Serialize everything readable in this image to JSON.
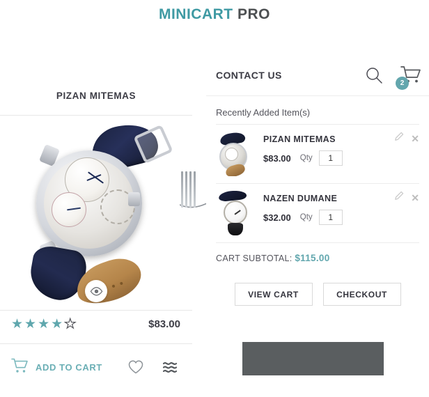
{
  "brand": {
    "title_primary": "MINICART",
    "title_secondary": "PRO"
  },
  "product_card": {
    "name": "PIZAN MITEMAS",
    "price": "$83.00",
    "rating_filled": 4,
    "rating_total": 5,
    "quickview_icon": "eye-icon",
    "add_to_cart_label": "ADD TO CART",
    "wishlist_icon": "heart-icon",
    "compare_icon": "compare-icon",
    "accent_color": "#6bafb5"
  },
  "minicart": {
    "contact_label": "CONTACT US",
    "search_icon": "search-icon",
    "cart_icon": "cart-icon",
    "cart_count": "2",
    "recent_title": "Recently Added Item(s)",
    "items": [
      {
        "name": "PIZAN MITEMAS",
        "price": "$83.00",
        "qty_label": "Qty",
        "qty_value": "1",
        "edit_icon": "pencil-icon",
        "remove_icon": "close-icon"
      },
      {
        "name": "NAZEN DUMANE",
        "price": "$32.00",
        "qty_label": "Qty",
        "qty_value": "1",
        "edit_icon": "pencil-icon",
        "remove_icon": "close-icon"
      }
    ],
    "subtotal_label": "CART SUBTOTAL:",
    "subtotal_amount": "$115.00",
    "view_cart_label": "VIEW CART",
    "checkout_label": "CHECKOUT",
    "accent_color": "#63a6ad"
  }
}
